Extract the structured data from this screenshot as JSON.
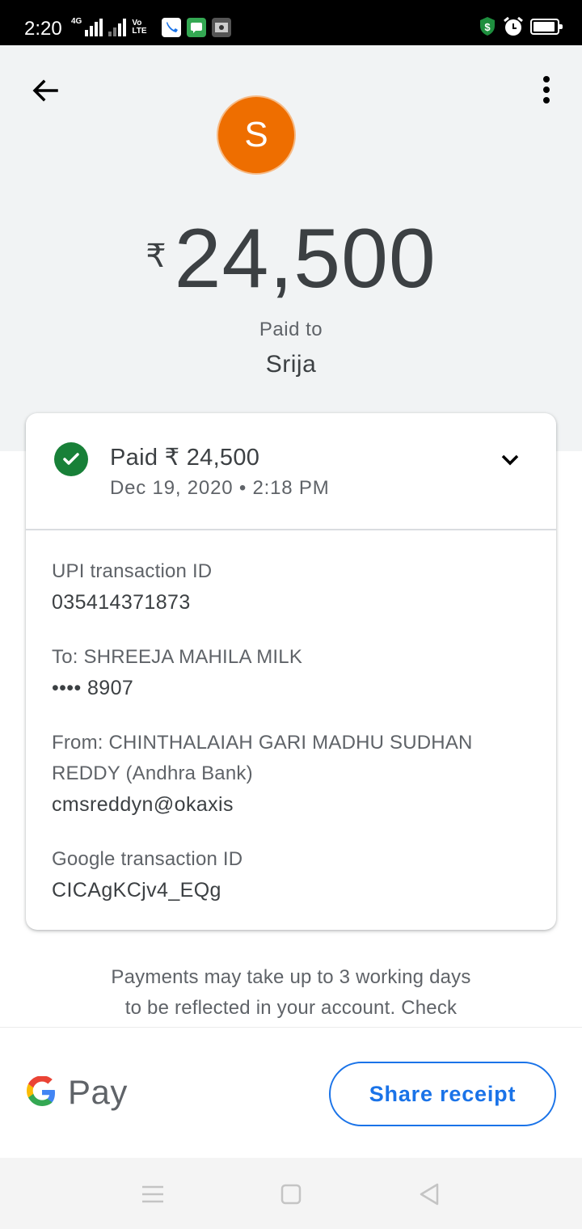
{
  "status_bar": {
    "time": "2:20",
    "network_tag": "4G",
    "volte_tag": "Vo LTE"
  },
  "header": {
    "avatar_initial": "S",
    "currency_symbol": "₹",
    "amount": "24,500",
    "paid_to_label": "Paid to",
    "payee_name": "Srija"
  },
  "card": {
    "title": "Paid ₹ 24,500",
    "date": "Dec 19, 2020 • 2:18 PM",
    "details": [
      {
        "label": "UPI transaction ID",
        "value": "035414371873"
      },
      {
        "label": "To: SHREEJA MAHILA MILK",
        "value": "•••• 8907"
      },
      {
        "label": "From: CHINTHALAIAH GARI MADHU SUDHAN REDDY (Andhra Bank)",
        "value": "cmsreddyn@okaxis"
      },
      {
        "label": "Google transaction ID",
        "value": "CICAgKCjv4_EQg"
      }
    ]
  },
  "footer": {
    "note_line1": "Payments may take up to 3 working days",
    "note_line2": "to be reflected in your account. Check",
    "brand_text": "Pay",
    "share_label": "Share receipt"
  },
  "colors": {
    "avatar": "#ee6e00",
    "success": "#188038",
    "accent": "#1a73e8",
    "header_bg": "#f1f3f4"
  },
  "icons": [
    "back-arrow-icon",
    "more-vert-icon",
    "check-circle-icon",
    "chevron-down-icon",
    "google-g-icon",
    "menu-icon",
    "home-icon",
    "back-triangle-icon"
  ]
}
